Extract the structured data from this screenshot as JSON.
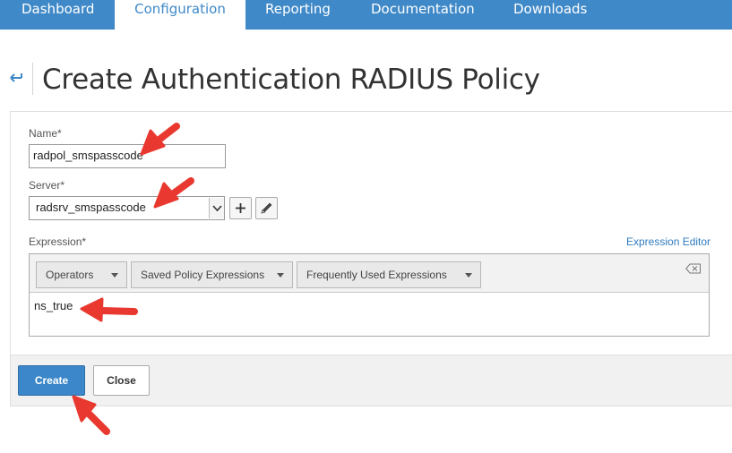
{
  "nav": {
    "tabs": [
      {
        "label": "Dashboard",
        "active": false
      },
      {
        "label": "Configuration",
        "active": true
      },
      {
        "label": "Reporting",
        "active": false
      },
      {
        "label": "Documentation",
        "active": false
      },
      {
        "label": "Downloads",
        "active": false
      }
    ]
  },
  "page": {
    "title": "Create Authentication RADIUS Policy",
    "back_icon": "back-arrow-icon"
  },
  "form": {
    "name_label": "Name*",
    "name_value": "radpol_smspasscode",
    "server_label": "Server*",
    "server_value": "radsrv_smspasscode",
    "add_icon": "plus-icon",
    "edit_icon": "pencil-icon",
    "expression_label": "Expression*",
    "expression_editor_link": "Expression Editor",
    "expression_menus": [
      "Operators",
      "Saved Policy Expressions",
      "Frequently Used Expressions"
    ],
    "clear_icon": "clear-icon",
    "expression_value": "ns_true"
  },
  "buttons": {
    "create": "Create",
    "close": "Close"
  },
  "colors": {
    "nav_bg": "#3f89c8",
    "primary_button": "#3c87c9",
    "link": "#2f7bbf",
    "annotation_arrow": "#e8382f"
  }
}
